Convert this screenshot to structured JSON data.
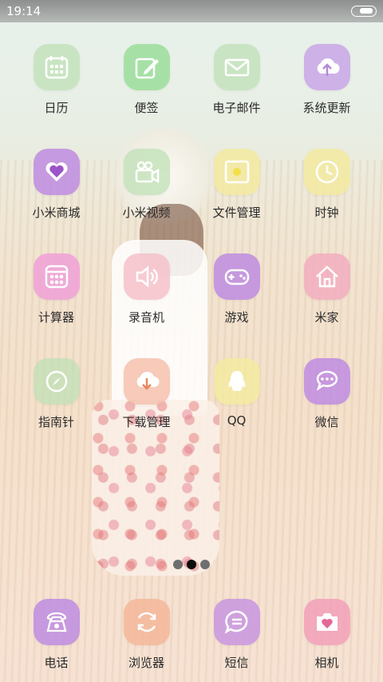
{
  "status_bar": {
    "time": "19:14"
  },
  "colors": {
    "green": "#bfe0b5",
    "purple": "#c9a6e6",
    "yellow": "#f3eaa0",
    "pink": "#f2b8d9",
    "peach": "#f5c6ad",
    "lavender": "#d8b9ec"
  },
  "apps": [
    [
      {
        "label": "日历",
        "icon": "calendar-icon"
      },
      {
        "label": "便签",
        "icon": "note-edit-icon"
      },
      {
        "label": "电子邮件",
        "icon": "mail-icon"
      },
      {
        "label": "系统更新",
        "icon": "cloud-upload-icon"
      }
    ],
    [
      {
        "label": "小米商城",
        "icon": "heart-icon"
      },
      {
        "label": "小米视频",
        "icon": "video-camera-icon"
      },
      {
        "label": "文件管理",
        "icon": "folder-icon"
      },
      {
        "label": "时钟",
        "icon": "clock-icon"
      }
    ],
    [
      {
        "label": "计算器",
        "icon": "calculator-icon"
      },
      {
        "label": "录音机",
        "icon": "speaker-icon"
      },
      {
        "label": "游戏",
        "icon": "gamepad-icon"
      },
      {
        "label": "米家",
        "icon": "home-icon"
      }
    ],
    [
      {
        "label": "指南针",
        "icon": "compass-icon"
      },
      {
        "label": "下载管理",
        "icon": "download-icon"
      },
      {
        "label": "QQ",
        "icon": "qq-penguin-icon"
      },
      {
        "label": "微信",
        "icon": "chat-bubble-icon"
      }
    ]
  ],
  "dock": [
    {
      "label": "电话",
      "icon": "phone-icon"
    },
    {
      "label": "浏览器",
      "icon": "refresh-icon"
    },
    {
      "label": "短信",
      "icon": "message-icon"
    },
    {
      "label": "相机",
      "icon": "camera-heart-icon"
    }
  ],
  "pager": {
    "pages": 3,
    "current": 2
  }
}
